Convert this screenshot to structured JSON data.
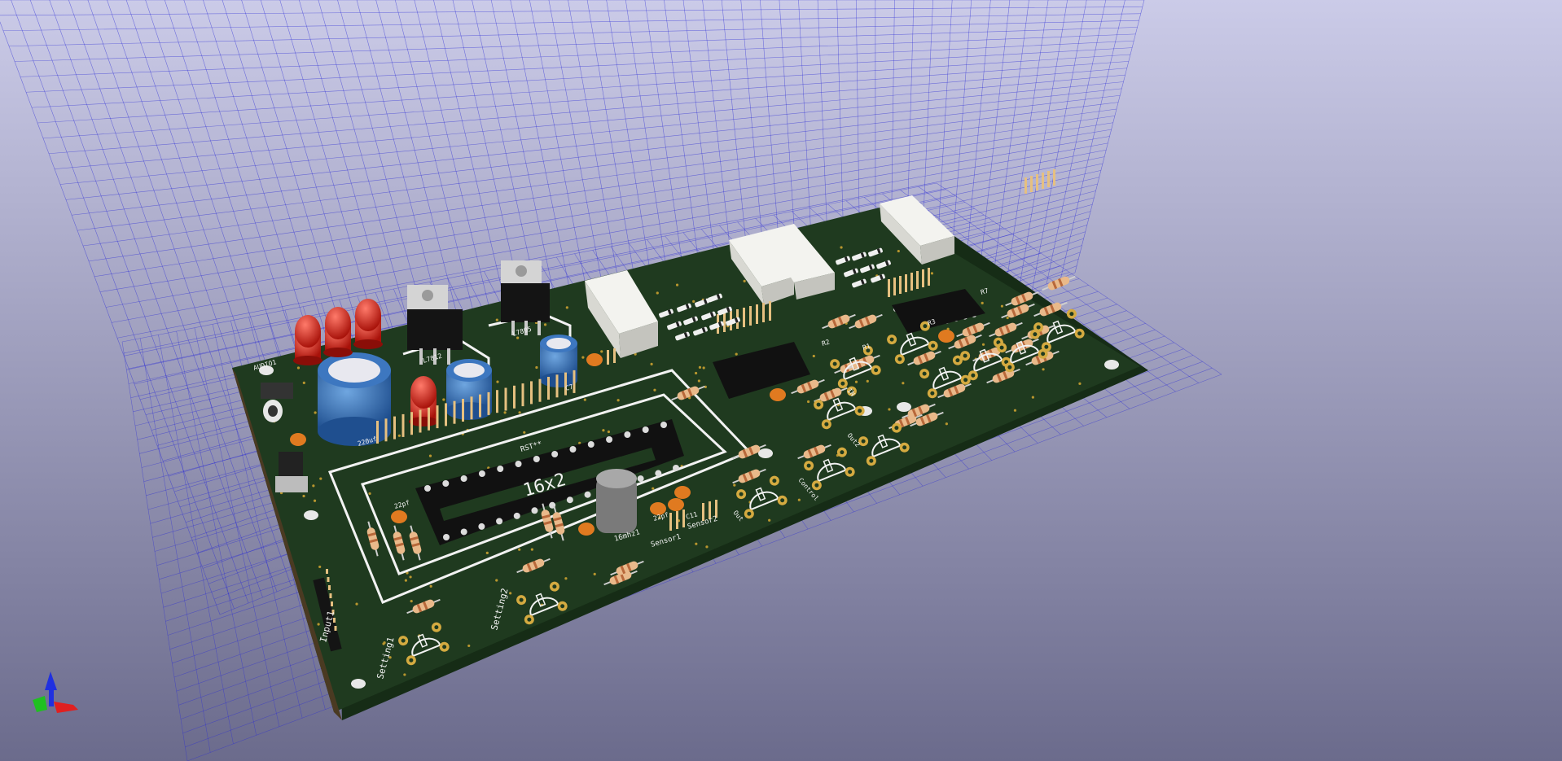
{
  "viewer": {
    "background_top": "#c9c9e6",
    "background_bottom": "#6a6a8a",
    "grid_color": "#2a2ad6",
    "board_color": "#1f3a1f",
    "silkscreen_color": "#f2f2f2"
  },
  "board": {
    "labels": {
      "lcd": "16x2",
      "reset": "RST**",
      "crystal": "16mhz1",
      "cap1": "22pf",
      "cap2": "22pf",
      "cap3": "C11",
      "reg1": "L7812",
      "reg2": "L7805",
      "cap_c7": "C7",
      "cap_220": "220uf",
      "power": "AUDIO1",
      "setting1": "Setting1",
      "setting2": "Setting2",
      "sensor1": "Sensor1",
      "sensor2": "Sensor2",
      "control": "Control",
      "input": "Input1",
      "out1": "Out",
      "out2": "Out2",
      "r1": "R1",
      "r2": "R2",
      "r3": "R3",
      "r7": "R7",
      "pin1": "IN"
    }
  },
  "axes": {
    "x_color": "#e02020",
    "y_color": "#20c020",
    "z_color": "#2030e0"
  }
}
